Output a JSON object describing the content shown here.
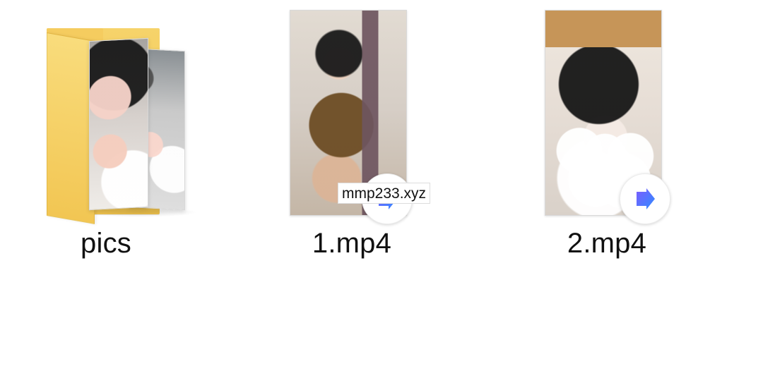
{
  "files": [
    {
      "label": "pics",
      "icon": "folder-icon"
    },
    {
      "label": "1.mp4",
      "icon": "video-file-icon"
    },
    {
      "label": "2.mp4",
      "icon": "video-file-icon"
    }
  ],
  "overlay": {
    "text": "mmp233.xyz"
  },
  "colors": {
    "background": "#ffffff",
    "folder_yellow": "#f3c64f",
    "play_blue": "#3d8ef7",
    "play_purple": "#7c5cff"
  }
}
